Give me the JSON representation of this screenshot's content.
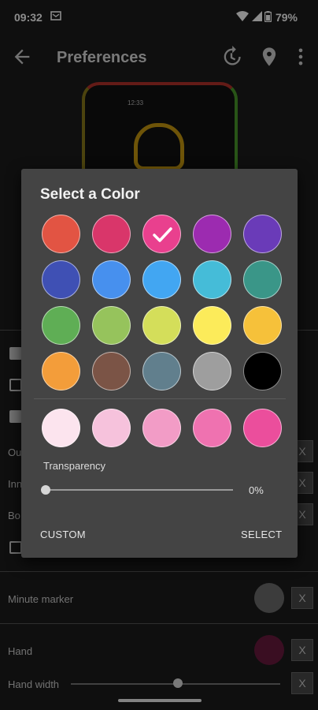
{
  "status_bar": {
    "time": "09:32",
    "battery": "79%"
  },
  "app_bar": {
    "title": "Preferences"
  },
  "preview": {
    "time_text": "12:33"
  },
  "settings": {
    "outer_label": "Ou",
    "inner_label": "Inn",
    "border_label": "Bo",
    "minute_marker_label": "Minute marker",
    "hand_label": "Hand",
    "hand_width_label": "Hand width",
    "x_label": "X"
  },
  "dialog": {
    "title": "Select a Color",
    "colors": [
      "#E25443",
      "#D9366A",
      "#E9408E",
      "#9C2BB0",
      "#6A3BB8",
      "#3F50B4",
      "#4790EE",
      "#42A6F2",
      "#45BCD8",
      "#3A9688",
      "#5FAE55",
      "#96C35C",
      "#D4DE5A",
      "#FCEB5A",
      "#F6C13A",
      "#F39D3A",
      "#7B5446",
      "#617F8D",
      "#9E9E9E",
      "#000000"
    ],
    "shades": [
      "#FCE4EE",
      "#F6C2DC",
      "#F29CC6",
      "#EF72B0",
      "#EB4E9C"
    ],
    "selected_index": 2,
    "transparency_label": "Transparency",
    "transparency_value": "0%",
    "transparency_level": 0,
    "custom_label": "CUSTOM",
    "select_label": "SELECT"
  },
  "colors": {
    "minute_marker_swatch": "#6E6E6E",
    "hand_swatch": "#6B1B3F"
  }
}
